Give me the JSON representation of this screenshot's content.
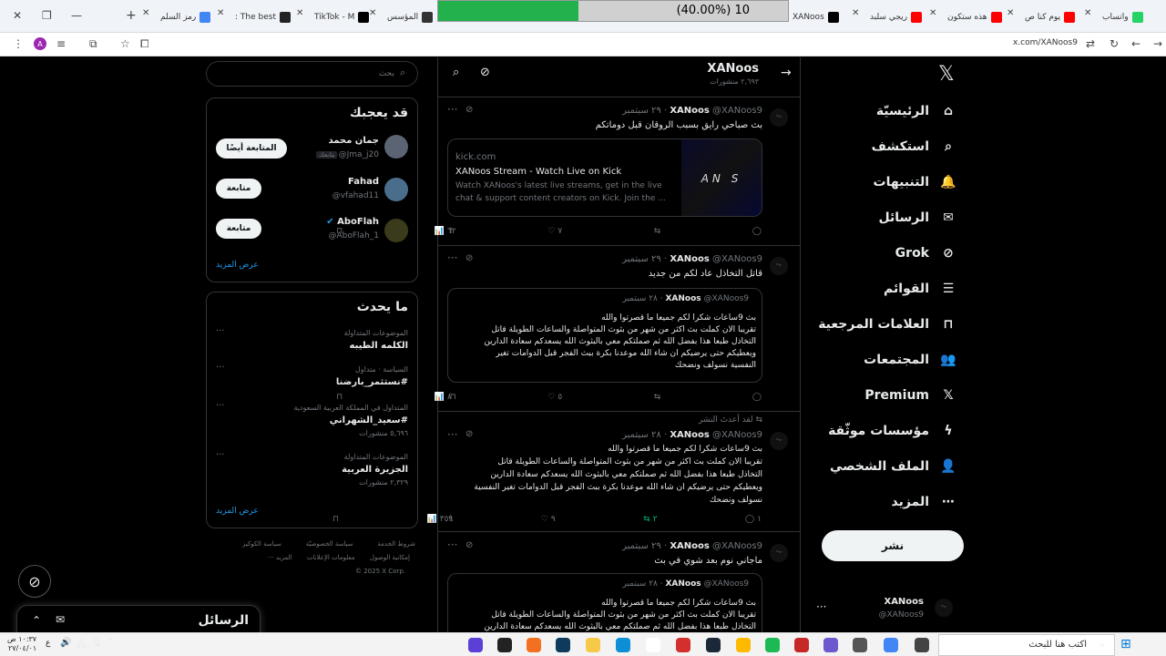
{
  "browser": {
    "tabs": [
      {
        "label": "واتساب",
        "color": "#25d366"
      },
      {
        "label": "يوم كنا ص",
        "color": "#ff0000"
      },
      {
        "label": "هذه ستكون",
        "color": "#ff0000"
      },
      {
        "label": "ريجي سلبد",
        "color": "#ff0000"
      },
      {
        "label": "XANoos",
        "color": "#000000"
      },
      {
        "label": "المؤسس",
        "color": "#333333"
      },
      {
        "label": "TikTok - M",
        "color": "#000000"
      },
      {
        "label": "The best :",
        "color": "#222222"
      },
      {
        "label": "رمز السلم",
        "color": "#4285f4"
      }
    ],
    "url": "x.com/XANoos9",
    "avatar_letter": "A"
  },
  "progress": {
    "text": "10 (40.00%)",
    "fraction": 0.4
  },
  "nav": {
    "items": [
      {
        "label": "الرئيسيّة",
        "icon": "home-icon"
      },
      {
        "label": "استكشف",
        "icon": "search-icon"
      },
      {
        "label": "التنبيهات",
        "icon": "bell-icon"
      },
      {
        "label": "الرسائل",
        "icon": "mail-icon"
      },
      {
        "label": "Grok",
        "icon": "grok-icon"
      },
      {
        "label": "القوائم",
        "icon": "list-icon"
      },
      {
        "label": "العلامات المرجعية",
        "icon": "bookmark-icon"
      },
      {
        "label": "المجتمعات",
        "icon": "communities-icon"
      },
      {
        "label": "Premium",
        "icon": "x-logo-icon"
      },
      {
        "label": "مؤسسات موثّقة",
        "icon": "lightning-icon"
      },
      {
        "label": "الملف الشخصي",
        "icon": "person-icon"
      },
      {
        "label": "المزيد",
        "icon": "more-icon"
      }
    ],
    "post_button": "نشر",
    "account": {
      "name": "XANoos",
      "handle": "@XANoos9"
    }
  },
  "profile": {
    "name": "XANoos",
    "posts": "٢,٦٩٣ منشورات"
  },
  "tweets": [
    {
      "name": "XANoos",
      "handle": "@XANoos9",
      "date": "٢٩ سبتمبر",
      "text": "بث صباحي رايق بسبب الروقان قبل دوماتكم",
      "card": {
        "domain": "kick.com",
        "title": "XANoos Stream - Watch Live on Kick",
        "desc1": "Watch XANoos's latest live streams, get in the live",
        "desc2": "chat & support content creators on Kick. Join the ..."
      },
      "stats": {
        "replies": "",
        "retweets": "",
        "likes": "٧",
        "views": "٦٢"
      }
    },
    {
      "name": "XANoos",
      "handle": "@XANoos9",
      "date": "٢٩ سبتمبر",
      "text": "قاتل التخاذل عاد لكم من جديد",
      "quote": {
        "name": "XANoos",
        "handle": "@XANoos9",
        "date": "٢٨ سبتمبر",
        "lines": [
          "بث 9ساعات شكرا لكم جميعا ما قصرتوا والله",
          "تقريبا الان كملت بث اكثر من شهر من بثوث المتواصلة والساعات الطويلة قاتل",
          "التخاذل طبعا هذا بفضل الله ثم صملتكم معي بالبثوث الله يسعدكم سعادة الدارين",
          "ويعطيكم حتى يرضيكم ان شاء الله موعدنا بكرة ببث الفجر قبل الدوامات  تغير",
          "النفسية نسولف ونضحك"
        ]
      },
      "stats": {
        "replies": "",
        "retweets": "",
        "likes": "٥",
        "views": "٨٦"
      }
    },
    {
      "repost_label": "لقد أعدتَ النشر",
      "name": "XANoos",
      "handle": "@XANoos9",
      "date": "٢٨ سبتمبر",
      "lines": [
        "بث 9ساعات شكرا لكم جميعا ما قصرتوا والله",
        "تقريبا الان كملت بث اكثر من شهر من بثوث المتواصلة والساعات الطويلة قاتل",
        "التخاذل طبعا هذا بفضل الله ثم صملتكم معي بالبثوث الله يسعدكم سعادة الدارين",
        "ويعطيكم حتى يرضيكم ان شاء الله موعدنا بكرة ببث الفجر قبل الدوامات  تغير النفسية",
        "نسولف ونضحك"
      ],
      "stats": {
        "replies": "١",
        "retweets": "٢",
        "likes": "٩",
        "views": "٣٥٩"
      }
    },
    {
      "name": "XANoos",
      "handle": "@XANoos9",
      "date": "٢٩ سبتمبر",
      "text": "ماجاني نوم بعد شوي في بث",
      "quote": {
        "name": "XANoos",
        "handle": "@XANoos9",
        "date": "٢٨ سبتمبر",
        "lines": [
          "بث 9ساعات شكرا لكم جميعا ما قصرتوا والله",
          "تقريبا الان كملت بث اكثر من شهر من بثوث المتواصلة والساعات الطويلة قاتل",
          "التخاذل طبعا هذا بفضل الله ثم صملتكم معي بالبثوث الله يسعدكم سعادة الدارين"
        ]
      }
    }
  ],
  "search": {
    "placeholder": "بحث"
  },
  "who_to_follow": {
    "title": "قد يعجبك",
    "users": [
      {
        "name": "جمان محمد",
        "handle": "@Jma_j20",
        "badge": "يتابعك",
        "button": "المتابعة أيضًا"
      },
      {
        "name": "Fahad",
        "handle": "@vfahad11",
        "button": "متابعة"
      },
      {
        "name": "AboFlah",
        "handle": "@AboFlah_1",
        "button": "متابعة"
      }
    ],
    "show_more": "عرض المزيد"
  },
  "trends": {
    "title": "ما يحدث",
    "items": [
      {
        "category": "الموضوعات المتداولة",
        "name": "الكلمه الطيبه",
        "count": ""
      },
      {
        "category": "السياسة · متداول",
        "name": "#نستثمر_بارضنا",
        "count": ""
      },
      {
        "category": "المتداول في المملكة العربية السعودية",
        "name": "#سعيد_الشهراني",
        "count": "٥,٦٩٦ منشورات"
      },
      {
        "category": "الموضوعات المتداولة",
        "name": "الجزيرة العربية",
        "count": "٢,٣٢٩ منشورات"
      }
    ],
    "show_more": "عرض المزيد"
  },
  "footer": {
    "row1": [
      "شروط الخدمة",
      "سياسة الخصوصيّة",
      "سياسة الكوكيز"
    ],
    "row2": [
      "إمكانية الوصول",
      "معلومات الإعلانات",
      "··· المزيد"
    ],
    "copyright": "© 2025 X Corp."
  },
  "messages_drawer": {
    "title": "الرسائل"
  },
  "taskbar": {
    "search_placeholder": "اكتب هنا للبحث",
    "time": "١٠:٣٧ ص",
    "date": "٢٧/٠٤/٠١",
    "lang": "ع"
  }
}
